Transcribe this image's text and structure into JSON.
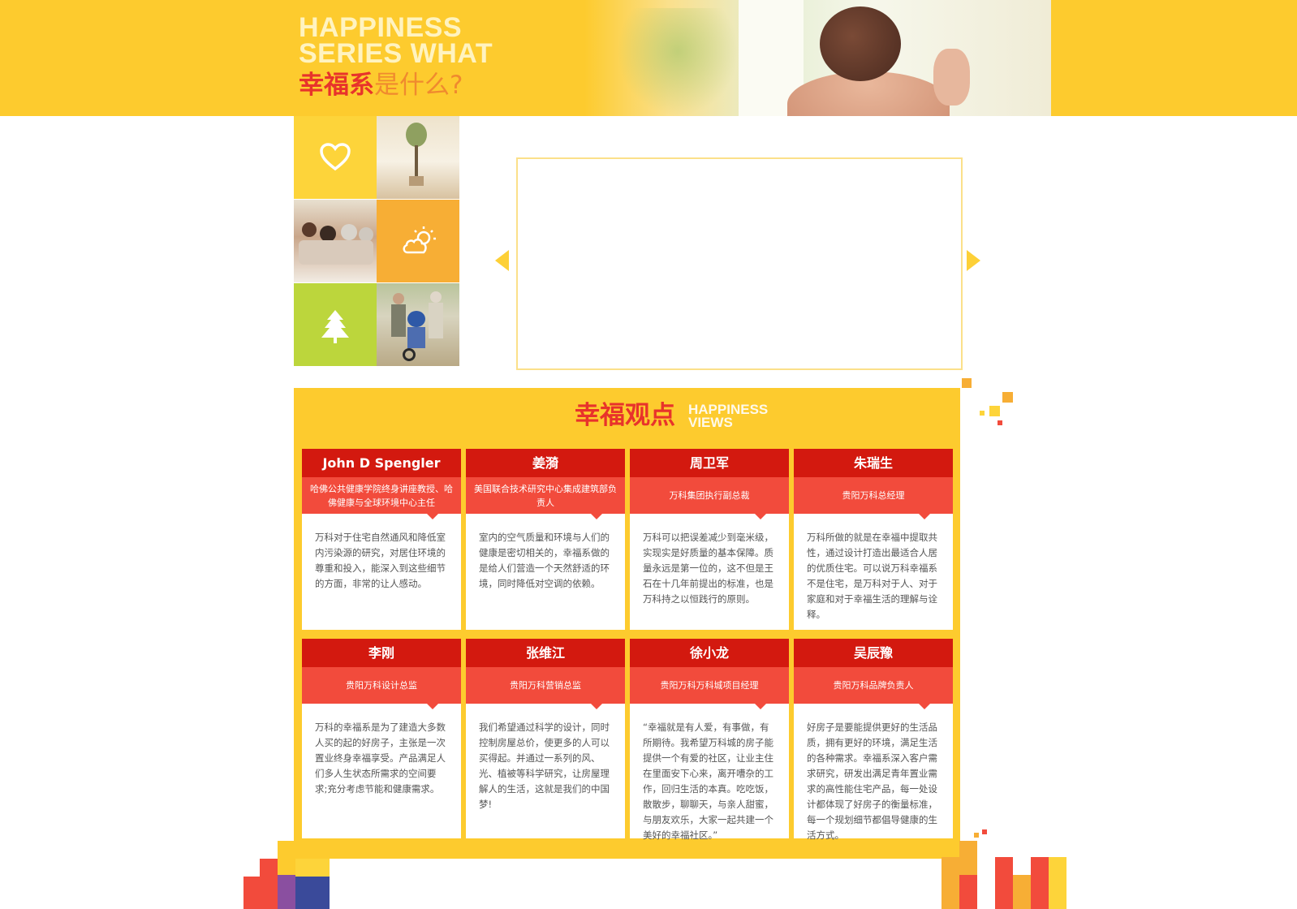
{
  "banner": {
    "title_en_line1": "HAPPINESS",
    "title_en_line2": "SERIES WHAT",
    "title_cn_highlight": "幸福系",
    "title_cn_rest": "是什么?"
  },
  "tiles": [
    {
      "icon": "heart-icon",
      "color": "#fdd43a"
    },
    {
      "icon": "sun-cloud-icon",
      "color": "#f7ae35"
    },
    {
      "icon": "tree-icon",
      "color": "#bcd63c"
    }
  ],
  "views": {
    "title_cn": "幸福观点",
    "title_en_line1": "HAPPINESS",
    "title_en_line2": "VIEWS",
    "cards": [
      {
        "name": "John D Spengler",
        "role": "哈佛公共健康学院终身讲座教授、哈佛健康与全球环境中心主任",
        "desc": "万科对于住宅自然通风和降低室内污染源的研究，对居住环境的尊重和投入，能深入到这些细节的方面，非常的让人感动。"
      },
      {
        "name": "姜漪",
        "role": "美国联合技术研究中心集成建筑部负责人",
        "desc": "室内的空气质量和环境与人们的健康是密切相关的，幸福系做的是给人们营造一个天然舒适的环境，同时降低对空调的依赖。"
      },
      {
        "name": "周卫军",
        "role": "万科集团执行副总裁",
        "desc": "万科可以把误差减少到毫米级，实现实是好质量的基本保障。质量永远是第一位的，这不但是王石在十几年前提出的标准，也是万科持之以恒践行的原则。"
      },
      {
        "name": "朱瑞生",
        "role": "贵阳万科总经理",
        "desc": "万科所做的就是在幸福中提取共性，通过设计打造出最适合人居的优质住宅。可以说万科幸福系不是住宅，是万科对于人、对于家庭和对于幸福生活的理解与诠释。"
      },
      {
        "name": "李刚",
        "role": "贵阳万科设计总监",
        "desc": "万科的幸福系是为了建造大多数人买的起的好房子，主张是一次置业终身幸福享受。产品满足人们多人生状态所需求的空间要求;充分考虑节能和健康需求。"
      },
      {
        "name": "张维江",
        "role": "贵阳万科营销总监",
        "desc": "我们希望通过科学的设计，同时控制房屋总价，使更多的人可以买得起。并通过一系列的风、光、植被等科学研究，让房屋理解人的生活，这就是我们的中国梦!"
      },
      {
        "name": "徐小龙",
        "role": "贵阳万科万科城项目经理",
        "desc": "“幸福就是有人爱，有事做，有所期待。我希望万科城的房子能提供一个有爱的社区，让业主住在里面安下心来，离开嘈杂的工作，回归生活的本真。吃吃饭，散散步，聊聊天，与亲人甜蜜，与朋友欢乐，大家一起共建一个美好的幸福社区。”"
      },
      {
        "name": "吴辰豫",
        "role": "贵阳万科品牌负责人",
        "desc": "好房子是要能提供更好的生活品质，拥有更好的环境，满足生活的各种需求。幸福系深入客户需求研究，研发出满足青年置业需求的高性能住宅产品，每一处设计都体现了好房子的衡量标准，每一个规划细节都倡导健康的生活方式。"
      }
    ]
  },
  "colors": {
    "brand_yellow": "#fdcb2e",
    "name_red": "#d3190f",
    "role_red": "#f24b3c",
    "title_red": "#e8332b"
  }
}
